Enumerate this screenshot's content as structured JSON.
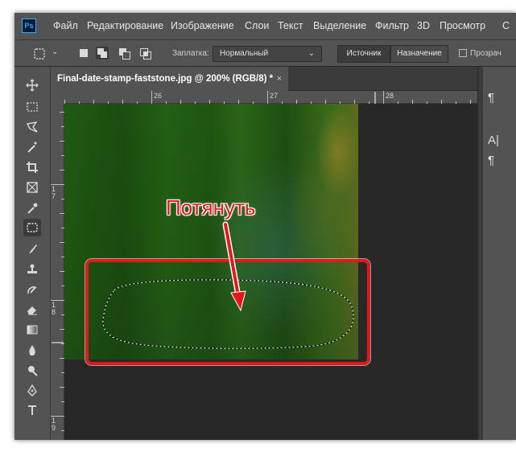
{
  "app": {
    "logo": "Ps",
    "menu": [
      "Файл",
      "Редактирование",
      "Изображение",
      "Слои",
      "Текст",
      "Выделение",
      "Фильтр",
      "3D",
      "Просмотр",
      "С"
    ]
  },
  "options": {
    "patch_label": "Заплатка:",
    "patch_mode": "Нормальный",
    "source_label": "Источник",
    "destination_label": "Назначение",
    "transparent_label": "Прозрач"
  },
  "document": {
    "tab_title": "Final-date-stamp-faststone.jpg @ 200% (RGB/8) *",
    "close_glyph": "×"
  },
  "rulers": {
    "h_ticks": [
      "26",
      "27",
      "28"
    ],
    "v_ticks": [
      "1\n7",
      "1\n8",
      "1\n9"
    ]
  },
  "annotation": {
    "label": "Потянуть",
    "color": "#e31919"
  },
  "panel": {
    "icons": [
      "paragraph-mark-icon",
      "character-icon",
      "paragraph-icon"
    ]
  }
}
